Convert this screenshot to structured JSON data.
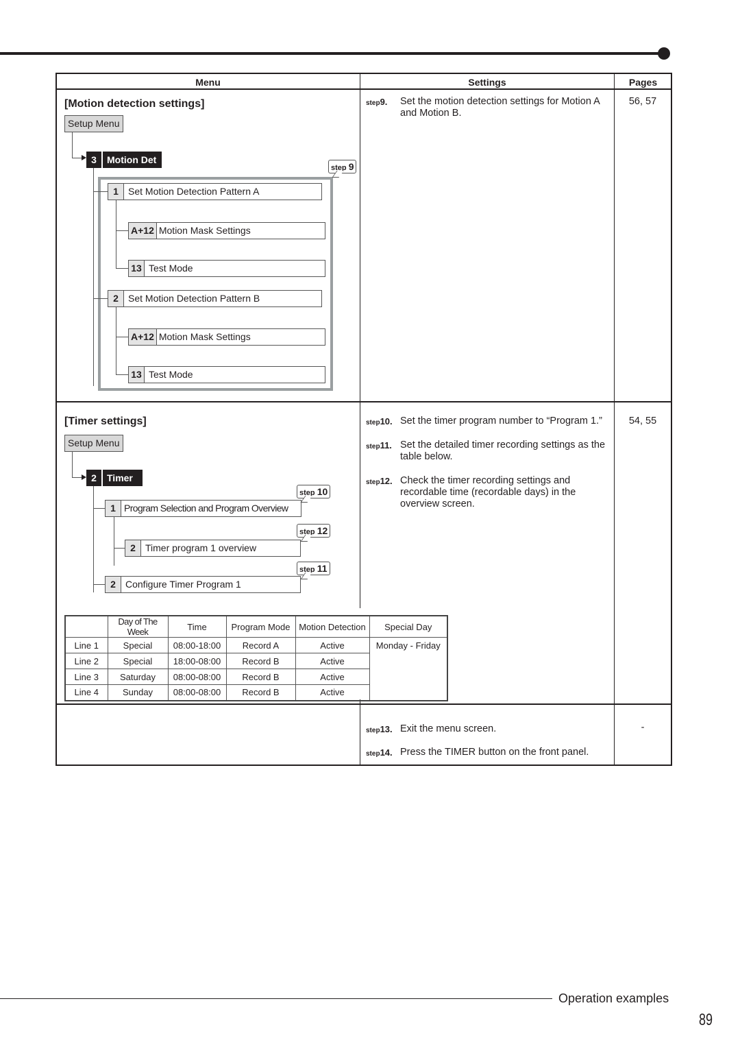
{
  "header": {
    "columns": {
      "menu": "Menu",
      "settings": "Settings",
      "pages": "Pages"
    }
  },
  "motion_section": {
    "title": "[Motion detection settings]",
    "setup_menu": "Setup Menu",
    "main_item": {
      "num": "3",
      "label": "Motion Det"
    },
    "callout": {
      "prefix": "step",
      "num": "9"
    },
    "items": [
      {
        "num": "1",
        "label": "Set Motion Detection Pattern A"
      },
      {
        "num": "A+12",
        "label": "Motion Mask Settings"
      },
      {
        "num": "13",
        "label": "Test Mode"
      },
      {
        "num": "2",
        "label": "Set Motion Detection Pattern B"
      },
      {
        "num": "A+12",
        "label": "Motion Mask Settings"
      },
      {
        "num": "13",
        "label": "Test Mode"
      }
    ],
    "steps": [
      {
        "prefix": "step",
        "num": "9.",
        "text": "Set the motion detection settings for Motion A and Motion B."
      }
    ],
    "pages": "56, 57"
  },
  "timer_section": {
    "title": "[Timer settings]",
    "setup_menu": "Setup Menu",
    "main_item": {
      "num": "2",
      "label": "Timer"
    },
    "items": [
      {
        "num": "1",
        "label": "Program Selection and Program Overview",
        "callout": "10"
      },
      {
        "num": "2",
        "label": "Timer program 1 overview",
        "callout": "12"
      },
      {
        "num": "2",
        "label": "Configure Timer Program 1",
        "callout": "11"
      }
    ],
    "callout_prefix": "step",
    "steps": [
      {
        "prefix": "step",
        "num": "10.",
        "text": "Set the timer program number to “Program 1.”"
      },
      {
        "prefix": "step",
        "num": "11.",
        "text": "Set the detailed timer recording settings as the table below."
      },
      {
        "prefix": "step",
        "num": "12.",
        "text": "Check the timer recording settings and recordable time (recordable days) in the overview screen."
      }
    ],
    "pages": "54, 55",
    "table": {
      "headers": [
        "",
        "Day of The Week",
        "Time",
        "Program Mode",
        "Motion Detection",
        "Special Day"
      ],
      "rows": [
        [
          "Line 1",
          "Special",
          "08:00-18:00",
          "Record A",
          "Active"
        ],
        [
          "Line 2",
          "Special",
          "18:00-08:00",
          "Record B",
          "Active"
        ],
        [
          "Line 3",
          "Saturday",
          "08:00-08:00",
          "Record B",
          "Active"
        ],
        [
          "Line 4",
          "Sunday",
          "08:00-08:00",
          "Record B",
          "Active"
        ]
      ],
      "special_day": "Monday - Friday"
    }
  },
  "final_section": {
    "steps": [
      {
        "prefix": "step",
        "num": "13.",
        "text": "Exit the menu screen."
      },
      {
        "prefix": "step",
        "num": "14.",
        "text": "Press the TIMER button on the front panel."
      }
    ],
    "pages": "-"
  },
  "footer": {
    "section_title": "Operation examples",
    "page_number": "89"
  }
}
